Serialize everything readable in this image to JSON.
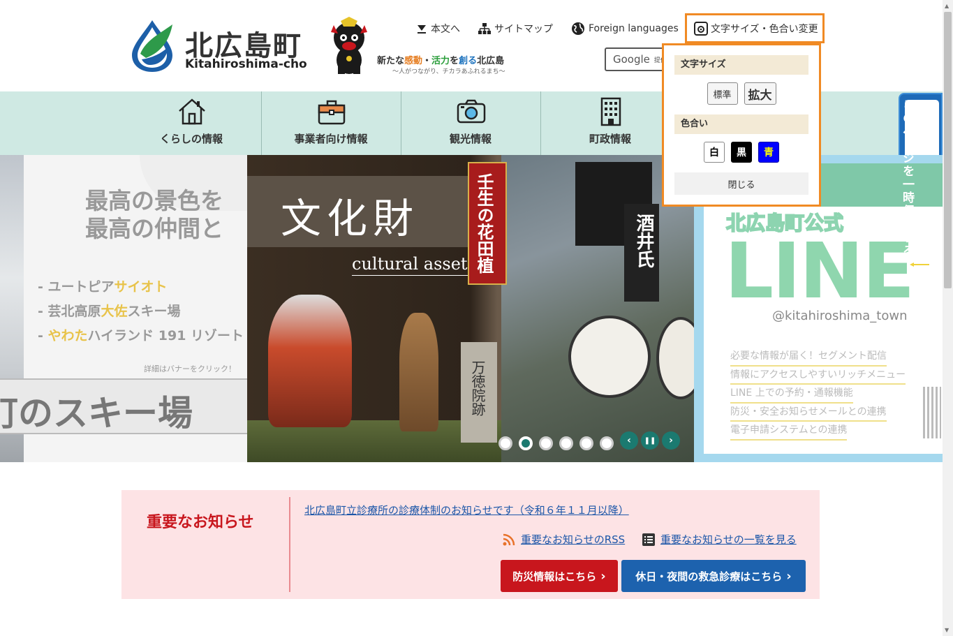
{
  "header": {
    "logo_title": "北広島町",
    "logo_sub": "Kitahiroshima-cho",
    "slogan_part1": "新たな",
    "slogan_part2": "感動",
    "slogan_part3": "・",
    "slogan_part4": "活力",
    "slogan_part5": "を",
    "slogan_part6": "創る",
    "slogan_part7": "北広島",
    "slogan_sub": "～人がつながり、チカラあふれるまち～",
    "search_placeholder": "Google",
    "search_provided": "提供"
  },
  "topnav": {
    "skip": "本文へ",
    "sitemap": "サイトマップ",
    "foreign": "Foreign languages",
    "font_color": "文字サイズ・色合い変更"
  },
  "popup": {
    "font_size_head": "文字サイズ",
    "standard": "標準",
    "enlarge": "拡大",
    "color_head": "色合い",
    "white": "白",
    "black": "黒",
    "blue": "青",
    "close": "閉じる"
  },
  "mainnav": {
    "items": [
      {
        "label": "くらしの情報",
        "icon": "house-icon"
      },
      {
        "label": "事業者向け情報",
        "icon": "briefcase-icon"
      },
      {
        "label": "観光情報",
        "icon": "camera-icon"
      },
      {
        "label": "町政情報",
        "icon": "building-icon"
      }
    ]
  },
  "sidetab": {
    "label": "このページを一時保存する",
    "open": "open"
  },
  "slides": {
    "ski": {
      "headline1": "最高の景色を",
      "headline2": "最高の仲間と",
      "item1_pre": "- ユートピア",
      "item1_hl": "サイオト",
      "item2_pre": "- 芸北高原",
      "item2_hl": "大佐",
      "item2_post": "スキー場",
      "item3_pre": "- ",
      "item3_hl": "やわた",
      "item3_post": "ハイランド 191 リゾート",
      "note": "詳細はバナーをクリック！",
      "big": "町のスキー場"
    },
    "culture": {
      "title": "文化財",
      "en": "cultural assets",
      "banner": "壬生の花田植",
      "flag": "酒井氏",
      "stone": "万徳院跡"
    },
    "line": {
      "title": "北広島町公式",
      "big": "LINE",
      "id": "@kitahiroshima_town",
      "features": [
        "必要な情報が届く！セグメント配信",
        "情報にアクセスしやすいリッチメニュー",
        "LINE 上での予約・通報機能",
        "防災・安全お知らせメールとの連携",
        "電子申請システムとの連携"
      ]
    },
    "dots": 6,
    "active_dot": 1
  },
  "notice": {
    "title": "重要なお知らせ",
    "link": "北広島町立診療所の診療体制のお知らせです（令和６年１１月以降）",
    "rss": "重要なお知らせのRSS",
    "list": "重要なお知らせの一覧を見る",
    "disaster": "防災情報はこちら",
    "emergency": "休日・夜間の救急診療はこちら"
  },
  "colors": {
    "accent_orange": "#f08a24",
    "nav_bg": "#cfe9e3",
    "notice_bg": "#fde3e5",
    "notice_red": "#c8161d",
    "link_blue": "#1b56a8",
    "teal": "#1b7a70"
  }
}
